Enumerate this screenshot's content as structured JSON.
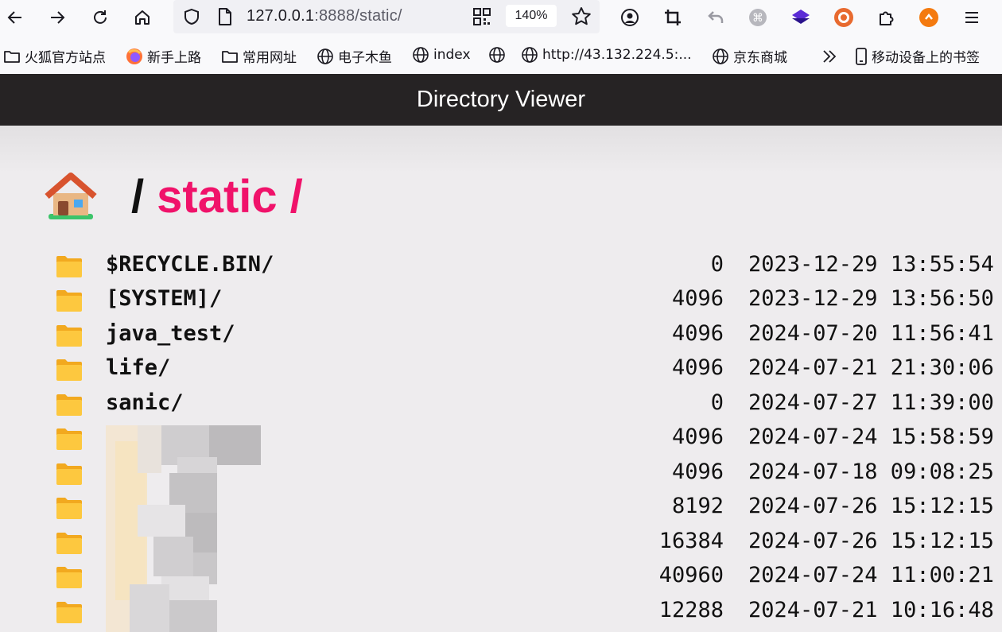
{
  "browser": {
    "url_host": "127.0.0.1",
    "url_rest": ":8888/static/",
    "zoom": "140%",
    "bookmarks": [
      "火狐官方站点",
      "新手上路",
      "常用网址",
      "电子木鱼",
      "index",
      "",
      "http://43.132.224.5:...",
      "京东商城",
      "移动设备上的书签"
    ]
  },
  "page": {
    "header_title": "Directory Viewer",
    "breadcrumb_slash": "/",
    "breadcrumb_dir": "static",
    "breadcrumb_tail": "/"
  },
  "entries": [
    {
      "name": "$RECYCLE.BIN/",
      "size": "0",
      "date": "2023-12-29 13:55:54"
    },
    {
      "name": "[SYSTEM]/",
      "size": "4096",
      "date": "2023-12-29 13:56:50"
    },
    {
      "name": "java_test/",
      "size": "4096",
      "date": "2024-07-20 11:56:41"
    },
    {
      "name": "life/",
      "size": "4096",
      "date": "2024-07-21 21:30:06"
    },
    {
      "name": "sanic/",
      "size": "0",
      "date": "2024-07-27 11:39:00"
    },
    {
      "name": "",
      "size": "4096",
      "date": "2024-07-24 15:58:59"
    },
    {
      "name": "",
      "size": "4096",
      "date": "2024-07-18 09:08:25"
    },
    {
      "name": "",
      "size": "8192",
      "date": "2024-07-26 15:12:15"
    },
    {
      "name": "",
      "size": "16384",
      "date": "2024-07-26 15:12:15"
    },
    {
      "name": "",
      "size": "40960",
      "date": "2024-07-24 11:00:21"
    },
    {
      "name": "",
      "size": "12288",
      "date": "2024-07-21 10:16:48"
    }
  ]
}
